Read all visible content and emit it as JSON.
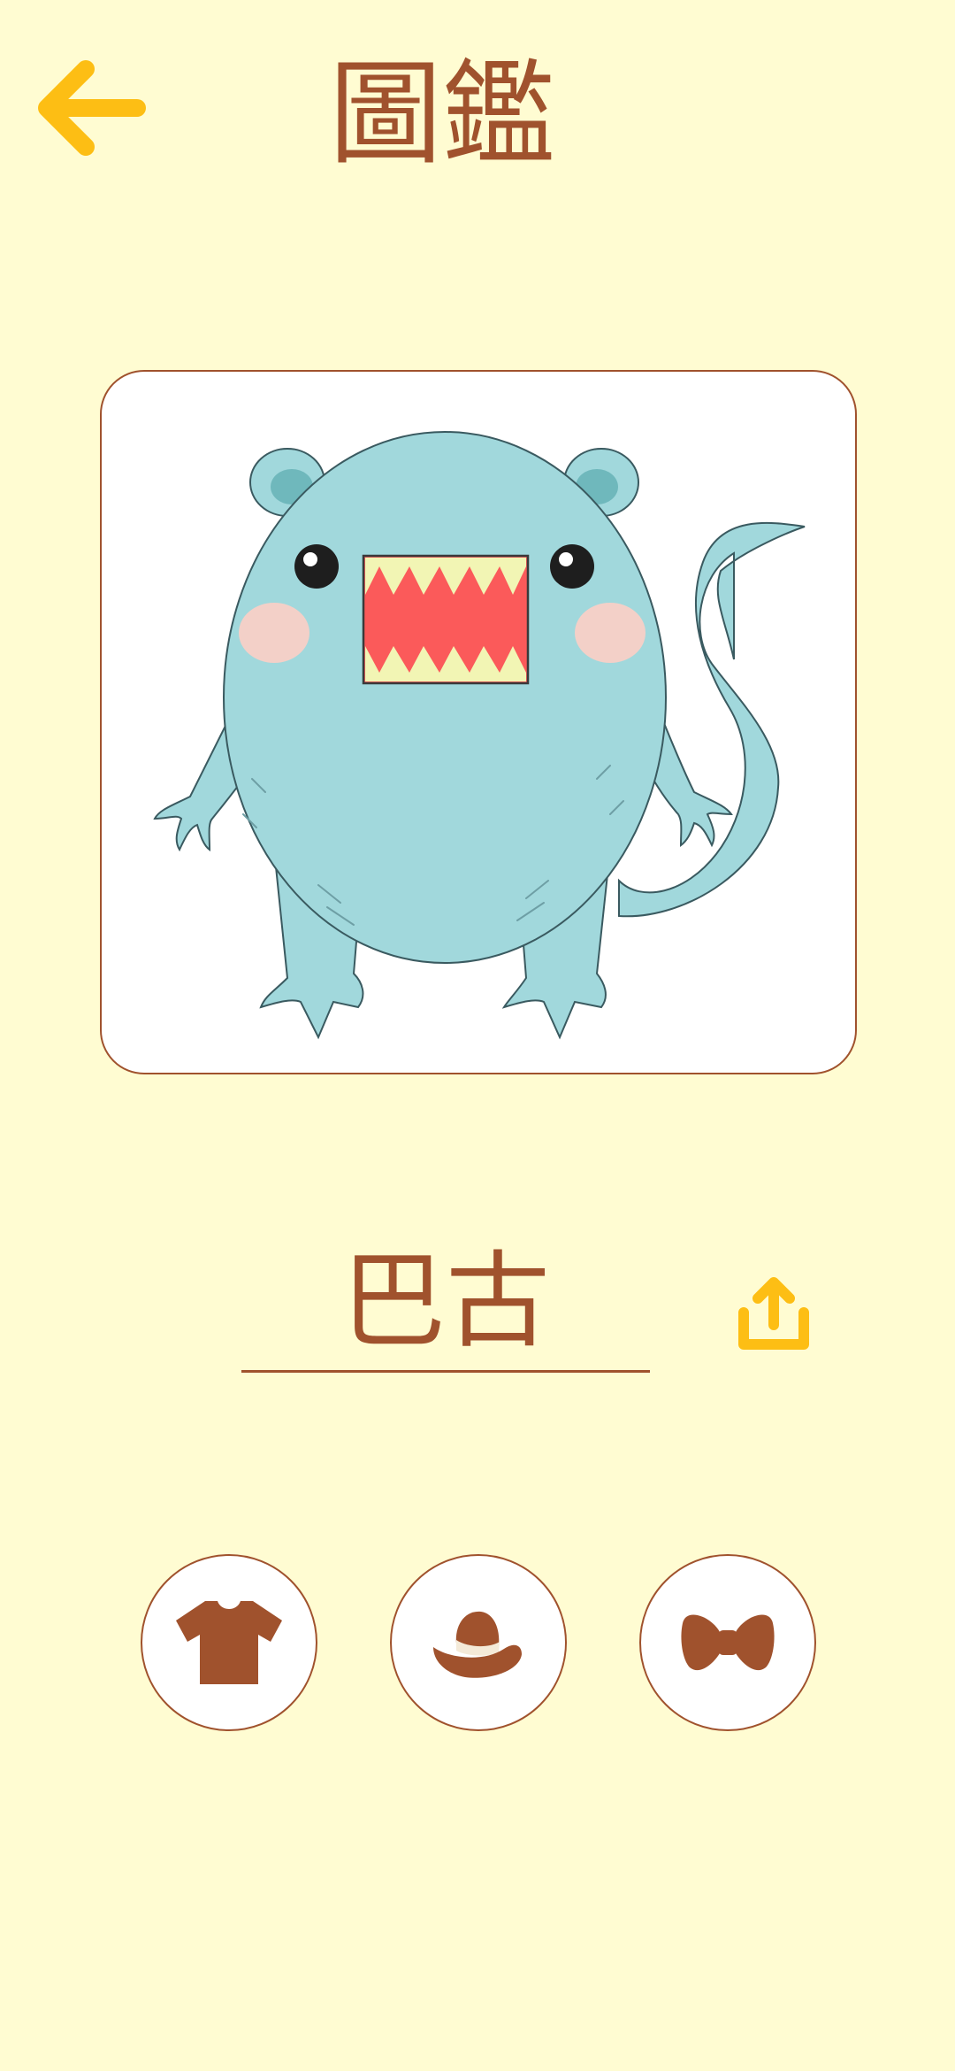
{
  "header": {
    "title": "圖鑑",
    "back_icon": "arrow-left-icon"
  },
  "creature": {
    "name": "巴古",
    "image": "blue-monster-illustration"
  },
  "actions": {
    "share_icon": "share-upload-icon"
  },
  "accessory_buttons": [
    {
      "icon": "tshirt-icon"
    },
    {
      "icon": "hat-icon"
    },
    {
      "icon": "bowtie-icon"
    }
  ],
  "colors": {
    "background": "#FFFCD2",
    "accent_brown": "#A0522D",
    "accent_yellow": "#FDBE14",
    "creature_body": "#A1D8DC"
  }
}
